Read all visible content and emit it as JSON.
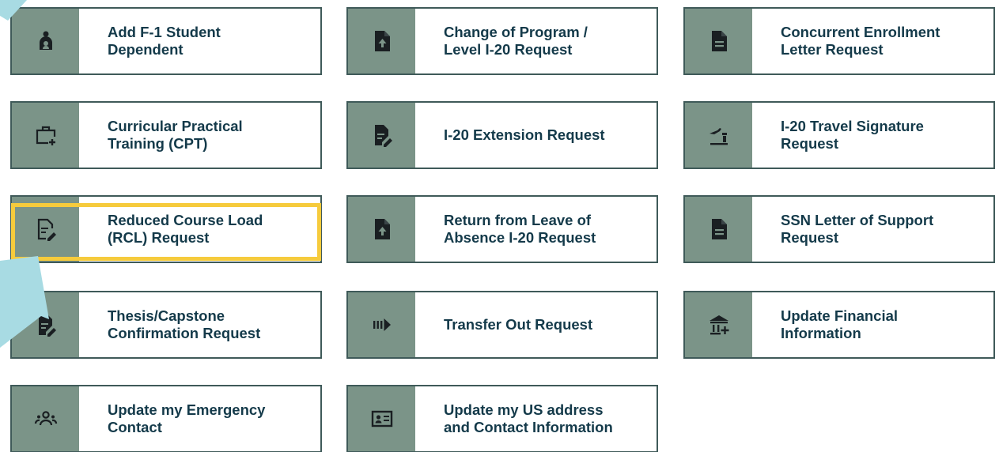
{
  "colors": {
    "border": "#3f5a59",
    "icon_background": "#7b9488",
    "label_text": "#143a4a",
    "highlight": "#f6cb3c",
    "pointer_arrow": "#a8dbe3"
  },
  "cards": [
    {
      "label": "Add F-1 Student\nDependent",
      "icon": "student-dependent-icon"
    },
    {
      "label": "Change of Program /\nLevel I-20 Request",
      "icon": "file-upload-icon"
    },
    {
      "label": "Concurrent Enrollment\nLetter Request",
      "icon": "document-icon"
    },
    {
      "label": "Curricular Practical\nTraining (CPT)",
      "icon": "briefcase-plus-icon"
    },
    {
      "label": "I-20 Extension Request",
      "icon": "file-edit-icon"
    },
    {
      "label": "I-20 Travel Signature\nRequest",
      "icon": "airplane-departure-icon"
    },
    {
      "label": "Reduced Course Load\n(RCL) Request",
      "icon": "file-edit-outline-icon"
    },
    {
      "label": "Return from Leave of\nAbsence I-20 Request",
      "icon": "file-upload-icon"
    },
    {
      "label": "SSN Letter of Support\nRequest",
      "icon": "document-icon"
    },
    {
      "label": "Thesis/Capstone\nConfirmation Request",
      "icon": "file-edit-icon"
    },
    {
      "label": "Transfer Out Request",
      "icon": "transfer-arrow-icon"
    },
    {
      "label": "Update Financial\nInformation",
      "icon": "bank-plus-icon"
    },
    {
      "label": "Update my Emergency\nContact",
      "icon": "group-contacts-icon"
    },
    {
      "label": "Update my US address\nand Contact Information",
      "icon": "contact-card-icon"
    }
  ]
}
